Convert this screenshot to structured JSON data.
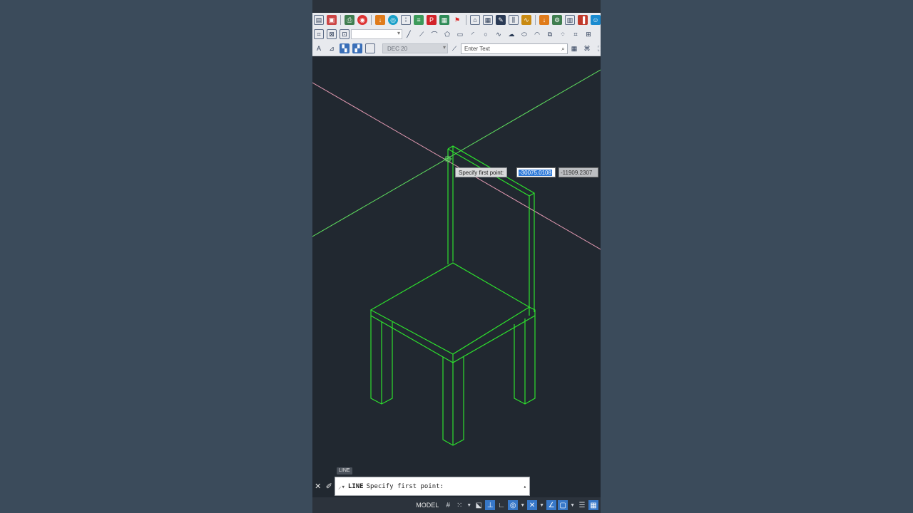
{
  "colors": {
    "canvas_bg": "#212830",
    "drawing_lines": "#2de02d",
    "cursor_axis_1": "#e39ab2",
    "cursor_axis_2": "#5fe05f",
    "status_active": "#3778c9"
  },
  "toolbar": {
    "row1_icons": [
      "new-icon",
      "save-icon",
      "print-icon",
      "plot-icon",
      "download-icon",
      "globe-icon",
      "match-icon",
      "layers-icon",
      "pdf-icon",
      "image-icon",
      "flag-icon",
      "house-icon",
      "grid-icon",
      "edit-icon",
      "ruler-icon",
      "wave-icon",
      "download-icon",
      "tools-icon",
      "calc-icon",
      "book-icon",
      "user-icon",
      "share-icon"
    ],
    "row2_icons": [
      "select-window-icon",
      "fence-icon",
      "crossing-icon",
      "polyline-icon",
      "line-icon",
      "arc-icon",
      "polygon-icon",
      "rectangle-icon",
      "curve-icon",
      "circle-icon",
      "spline-icon",
      "cloud-icon",
      "ellipse-icon",
      "ellipse-arc-icon",
      "insert-icon",
      "point-icon",
      "hatch-icon",
      "table-icon"
    ],
    "row3_icons": [
      "text-style-icon",
      "dim-style-icon",
      "layer-state-icon",
      "group-icon",
      "viewport-icon",
      "measure-icon",
      "grid-view-icon",
      "isometric-icon",
      "gizmo-icon"
    ],
    "dimstyle_value": "DEC 20",
    "search_placeholder": "Enter Text"
  },
  "dynamic_input": {
    "prompt": "Specify first point:",
    "x_value": "-30075.0108",
    "y_value": "-11909.2307"
  },
  "command": {
    "tag": "LINE",
    "name": "LINE",
    "prompt": "Specify first point:"
  },
  "statusbar": {
    "model_label": "MODEL",
    "icons": [
      "grid-icon",
      "snap-icon",
      "infer-icon",
      "ortho-icon",
      "polar-icon",
      "isodraft-icon",
      "osnap-track-icon",
      "osnap-icon",
      "lineweight-icon",
      "transparency-icon",
      "selection-cycle-icon",
      "customize-icon"
    ],
    "active": [
      "ortho-icon",
      "polar-icon",
      "osnap-icon",
      "lineweight-icon"
    ]
  }
}
